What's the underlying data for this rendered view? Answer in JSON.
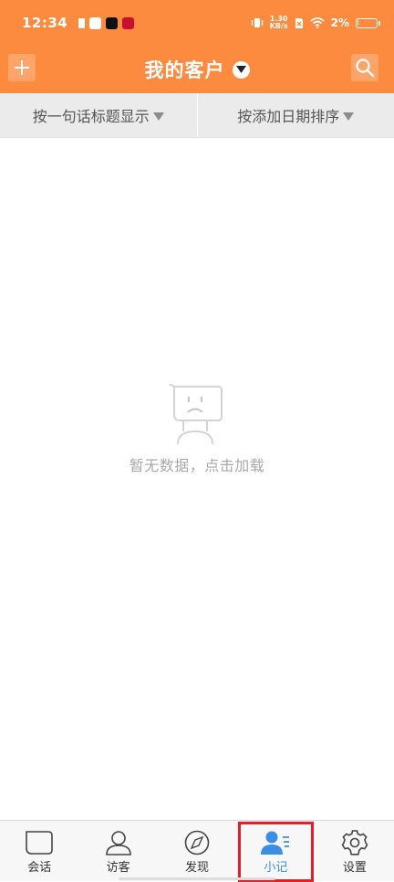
{
  "status_bar": {
    "time": "12:34",
    "net_speed_value": "1.30",
    "net_speed_unit": "KB/s",
    "battery_text": "2%",
    "battery_level": 0.02
  },
  "header": {
    "title": "我的客户"
  },
  "filters": {
    "left_label": "按一句话标题显示",
    "right_label": "按添加日期排序"
  },
  "empty_state": {
    "message": "暂无数据，点击加载"
  },
  "bottom_nav": {
    "items": [
      {
        "label": "会话",
        "icon": "chat-icon"
      },
      {
        "label": "访客",
        "icon": "visitor-icon"
      },
      {
        "label": "发现",
        "icon": "compass-icon"
      },
      {
        "label": "小记",
        "icon": "notes-person-icon",
        "active": true
      },
      {
        "label": "设置",
        "icon": "gear-icon"
      }
    ]
  },
  "colors": {
    "brand": "#fc8b3f",
    "active": "#3a8ee6",
    "highlight_border": "#e0202a"
  }
}
